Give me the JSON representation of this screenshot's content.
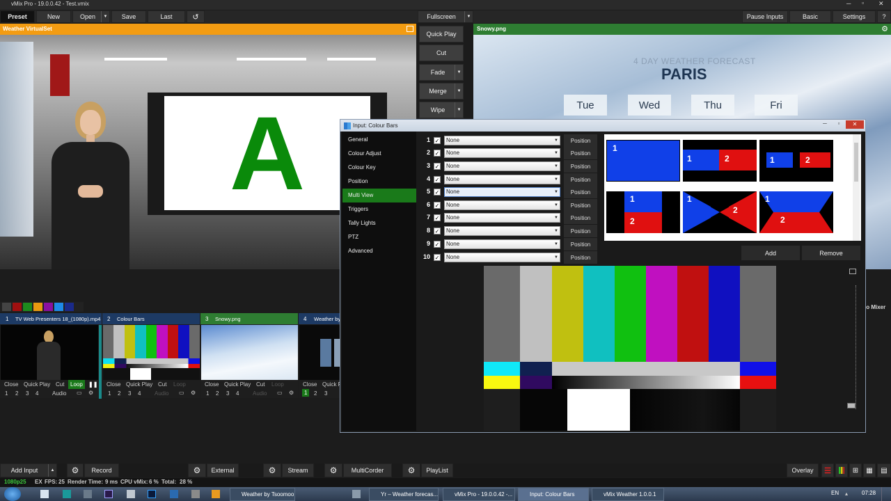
{
  "app": {
    "title": "vMix Pro - 19.0.0.42 - Test.vmix"
  },
  "toolbar": {
    "preset": "Preset",
    "new": "New",
    "open": "Open",
    "save": "Save",
    "last": "Last",
    "fullscreen": "Fullscreen",
    "pause_inputs": "Pause Inputs",
    "basic": "Basic",
    "settings": "Settings"
  },
  "preview": {
    "title": "Weather VirtualSet",
    "screen_letter": "A"
  },
  "transitions": [
    "Quick Play",
    "Cut",
    "Fade",
    "Merge",
    "Wipe"
  ],
  "output": {
    "title": "Snowy.png",
    "forecast_heading": "4 DAY WEATHER FORECAST",
    "city": "PARIS",
    "days": [
      "Tue",
      "Wed",
      "Thu",
      "Fri"
    ]
  },
  "dialog": {
    "title": "Input: Colour Bars",
    "menu": [
      "General",
      "Colour Adjust",
      "Colour Key",
      "Position",
      "Multi View",
      "Triggers",
      "Tally Lights",
      "PTZ",
      "Advanced"
    ],
    "active_menu": "Multi View",
    "rows": [
      {
        "num": "1",
        "value": "None",
        "btn": "Position"
      },
      {
        "num": "2",
        "value": "None",
        "btn": "Position"
      },
      {
        "num": "3",
        "value": "None",
        "btn": "Position"
      },
      {
        "num": "4",
        "value": "None",
        "btn": "Position"
      },
      {
        "num": "5",
        "value": "None",
        "btn": "Position"
      },
      {
        "num": "6",
        "value": "None",
        "btn": "Position"
      },
      {
        "num": "7",
        "value": "None",
        "btn": "Position"
      },
      {
        "num": "8",
        "value": "None",
        "btn": "Position"
      },
      {
        "num": "9",
        "value": "None",
        "btn": "Position"
      },
      {
        "num": "10",
        "value": "None",
        "btn": "Position"
      }
    ],
    "add": "Add",
    "remove": "Remove",
    "thumb_labels": [
      "1",
      "1",
      "2",
      "1",
      "2",
      "1",
      "2",
      "1",
      "2",
      "1",
      "2"
    ]
  },
  "inputs": [
    {
      "num": "1",
      "name": "TV Web Presenters 18_(1080p).mp4",
      "controls": [
        "Close",
        "Quick Play",
        "Cut",
        "Loop"
      ],
      "sub": [
        "1",
        "2",
        "3",
        "4",
        "Audio"
      ]
    },
    {
      "num": "2",
      "name": "Colour Bars",
      "controls": [
        "Close",
        "Quick Play",
        "Cut",
        "Loop"
      ],
      "sub": [
        "1",
        "2",
        "3",
        "4",
        "Audio"
      ]
    },
    {
      "num": "3",
      "name": "Snowy.png",
      "controls": [
        "Close",
        "Quick Play",
        "Cut",
        "Loop"
      ],
      "sub": [
        "1",
        "2",
        "3",
        "4",
        "Audio"
      ]
    },
    {
      "num": "4",
      "name": "Weather by",
      "controls": [
        "Close",
        "Quick P"
      ],
      "sub": [
        "1",
        "2",
        "3"
      ]
    }
  ],
  "audio_mixer_label": "io Mixer",
  "bottom": {
    "add_input": "Add Input",
    "record": "Record",
    "external": "External",
    "stream": "Stream",
    "multicorder": "MultiCorder",
    "playlist": "PlayList",
    "overlay": "Overlay"
  },
  "status": {
    "res": "1080p25",
    "ex": "EX",
    "fps_label": "FPS:",
    "fps": "25",
    "render_label": "Render Time:",
    "render": "9 ms",
    "cpu_label": "CPU vMix:",
    "cpu": "6 %",
    "total_label": "Total:",
    "total": "28 %"
  },
  "taskbar": {
    "items": [
      "Weather by Tsoomoo",
      "Yr – Weather forecas...",
      "vMix Pro - 19.0.0.42 -...",
      "Input: Colour Bars",
      "vMix Weather 1.0.0.1"
    ],
    "lang": "EN",
    "time": "07:28"
  },
  "colors": {
    "preview_bar": "#f39c12",
    "output_bar": "#2e7d32",
    "active_green": "#1a7a1a",
    "dialog_bg": "#1e1e1e"
  }
}
